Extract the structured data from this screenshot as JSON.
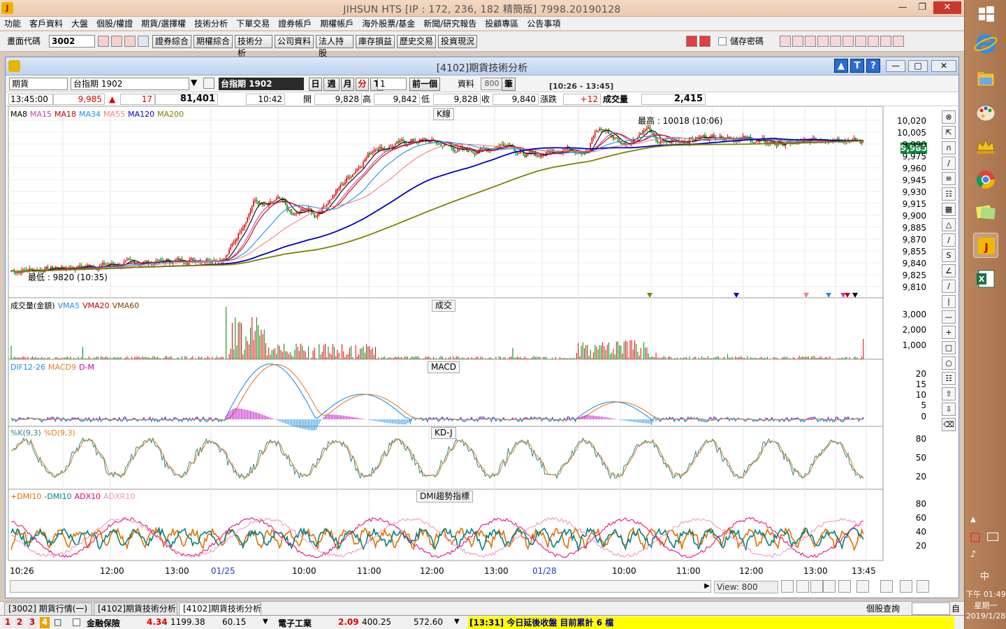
{
  "app": {
    "title": "JIHSUN HTS      [IP : 172, 236, 182 精簡版] 7998.20190128"
  },
  "menu": [
    "功能",
    "客戶資料",
    "大盤",
    "個股/權證",
    "期貨/選擇權",
    "技術分析",
    "下單交易",
    "證券帳戶",
    "期權帳戶",
    "海外股票/基金",
    "新聞/研究報告",
    "投顧專區",
    "公告事項"
  ],
  "toolbar": {
    "code_label": "畫面代碼",
    "code_value": "3002",
    "buttons": [
      "證券綜合",
      "期權綜合",
      "技術分析",
      "公司資料",
      "法人持股",
      "庫存損益",
      "歷史交易",
      "投資現況"
    ],
    "save_password_label": "儲存密碼"
  },
  "chart_window": {
    "title": "[4102]期貨技術分析",
    "market_select": "期貨",
    "symbol_select": "台指期 1902",
    "symbol_display": "台指期 1902",
    "period_buttons": [
      "日",
      "週",
      "月",
      "分",
      "T"
    ],
    "active_period": "分",
    "interval_value": "1",
    "prev_button": "前一個",
    "data_label": "資料",
    "data_count": "800",
    "unit_label": "筆",
    "range_label": "[10:26 - 13:45]"
  },
  "quote": {
    "time": "13:45:00",
    "price": "9,985",
    "change": "17",
    "volume_total": "81,401",
    "cursor_time": "10:42",
    "open_label": "開",
    "open": "9,828",
    "high_label": "高",
    "high": "9,842",
    "low_label": "低",
    "low": "9,828",
    "close_label": "收",
    "close": "9,840",
    "chg_label": "漲跌",
    "chg": "+12",
    "vol_label": "成交量",
    "vol": "2,415"
  },
  "panels": {
    "kline": {
      "title": "K線",
      "ma_labels": [
        [
          "MA8",
          "#000000"
        ],
        [
          "MA15",
          "#c040c0"
        ],
        [
          "MA18",
          "#c00000"
        ],
        [
          "MA34",
          "#2090e0"
        ],
        [
          "MA55",
          "#f08080"
        ],
        [
          "MA120",
          "#0000c0"
        ],
        [
          "MA200",
          "#808000"
        ]
      ],
      "high_note": "最高 : 10018 (10:06)",
      "low_note": "最低 : 9820 (10:35)",
      "last_price": "9,985",
      "y_ticks": [
        "10,020",
        "10,005",
        "9,990",
        "9,975",
        "9,960",
        "9,945",
        "9,930",
        "9,915",
        "9,900",
        "9,885",
        "9,870",
        "9,855",
        "9,840",
        "9,825",
        "9,810"
      ]
    },
    "volume": {
      "title": "成交",
      "labels": [
        [
          "成交量(金額)",
          "#000000"
        ],
        [
          "VMA5",
          "#2090e0"
        ],
        [
          "VMA20",
          "#c00000"
        ],
        [
          "VMA60",
          "#804000"
        ]
      ],
      "y_ticks": [
        "3,000",
        "2,000",
        "1,000"
      ]
    },
    "macd": {
      "title": "MACD",
      "labels": [
        [
          "DIF12-26",
          "#2090e0"
        ],
        [
          "MACD9",
          "#e08030"
        ],
        [
          "D-M",
          "#c000c0"
        ]
      ],
      "y_ticks": [
        "20",
        "15",
        "10",
        "5",
        "0"
      ]
    },
    "kd": {
      "title": "KD-J",
      "labels": [
        [
          "%K(9,3)",
          "#2a8a8a"
        ],
        [
          "%D(9,3)",
          "#e08020"
        ]
      ],
      "y_ticks": [
        "80",
        "50",
        "20"
      ]
    },
    "dmi": {
      "title": "DMI趨勢指標",
      "labels": [
        [
          "+DMI10",
          "#e07000"
        ],
        [
          "-DMI10",
          "#008080"
        ],
        [
          "ADX10",
          "#e0007a"
        ],
        [
          "ADXR10",
          "#f090c0"
        ]
      ],
      "y_ticks": [
        "80",
        "60",
        "40",
        "20"
      ]
    }
  },
  "x_axis": [
    "10:26",
    "12:00",
    "13:00",
    "01/25",
    "10:00",
    "11:00",
    "12:00",
    "13:00",
    "01/28",
    "10:00",
    "11:00",
    "12:00",
    "13:00",
    "13:45"
  ],
  "view_label": "View: 800",
  "tabs": [
    "[3002] 期貨行情(一)",
    "[4102]期貨技術分析",
    "[4102]期貨技術分析"
  ],
  "status": {
    "stock_query": "個股查詢",
    "auto": "自"
  },
  "ticker": {
    "items": [
      {
        "name": "金融保險",
        "chg": "4.34",
        "index": "1199.38",
        "val": "60.15"
      },
      {
        "name": "電子工業",
        "chg": "2.09",
        "index": "400.25",
        "val": "572.60"
      }
    ],
    "message": "[13:31] 今日延後收盤  目前累計 6 檔"
  },
  "system_tray": {
    "ime": "中",
    "time": "下午 01:49",
    "day": "星期一",
    "date": "2019/1/28"
  }
}
